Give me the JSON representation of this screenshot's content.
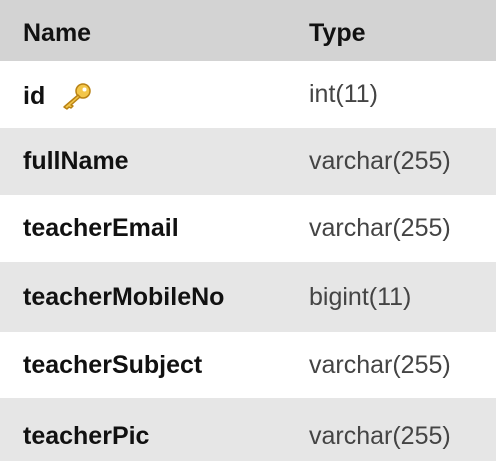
{
  "columns": {
    "name_header": "Name",
    "type_header": "Type"
  },
  "rows": [
    {
      "name": "id",
      "type": "int(11)",
      "icon": "primary-key-icon"
    },
    {
      "name": "fullName",
      "type": "varchar(255)"
    },
    {
      "name": "teacherEmail",
      "type": "varchar(255)"
    },
    {
      "name": "teacherMobileNo",
      "type": "bigint(11)"
    },
    {
      "name": "teacherSubject",
      "type": "varchar(255)"
    },
    {
      "name": "teacherPic",
      "type": "varchar(255)"
    }
  ],
  "colors": {
    "header_bg": "#d3d3d3",
    "row_shade_bg": "#e6e6e6",
    "row_plain_bg": "#ffffff",
    "key_icon": "#e8b33a"
  }
}
